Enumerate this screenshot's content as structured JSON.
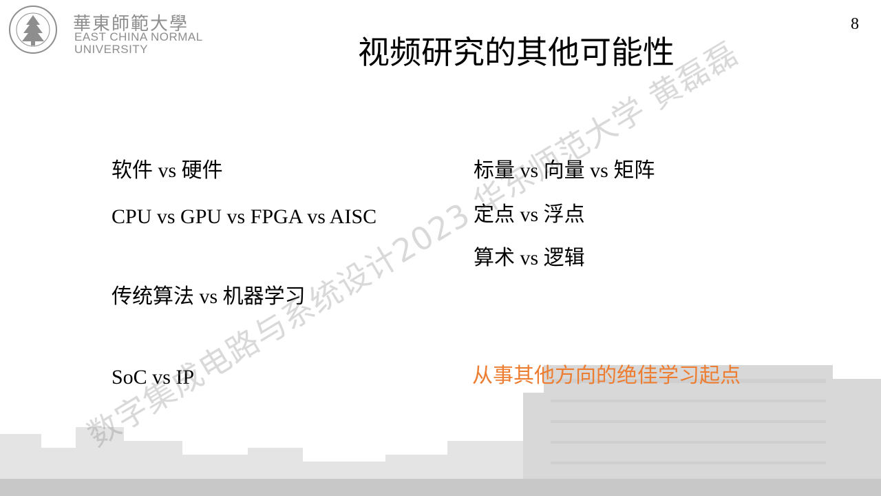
{
  "logo": {
    "cn_name": "華東師範大學",
    "en_line1": "EAST CHINA NORMAL",
    "en_line2": "UNIVERSITY",
    "seal_icon": "ecnu-seal-icon"
  },
  "page_number": "8",
  "title": "视频研究的其他可能性",
  "left_items": [
    "软件 vs 硬件",
    "CPU vs GPU vs FPGA vs AISC",
    "传统算法 vs 机器学习",
    "SoC vs IP"
  ],
  "right_items": [
    "标量 vs 向量 vs 矩阵",
    "定点 vs 浮点",
    "算术 vs 逻辑"
  ],
  "highlight": "从事其他方向的绝佳学习起点",
  "watermark": "数字集成电路与系统设计2023 华东师范大学 黄磊磊",
  "colors": {
    "accent": "#ed7d31",
    "text": "#000000",
    "logo_gray": "#8e8e8e"
  }
}
